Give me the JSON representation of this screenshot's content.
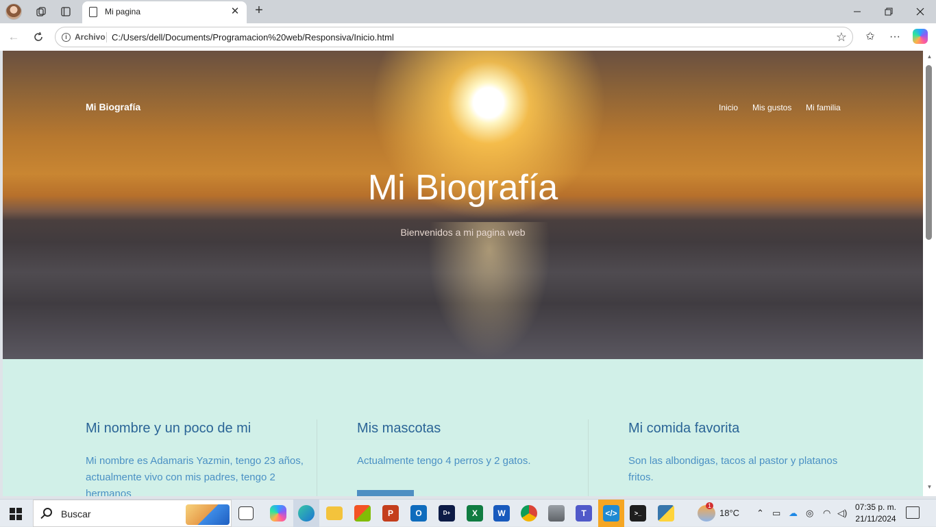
{
  "browser": {
    "tab_title": "Mi pagina",
    "close_glyph": "✕",
    "new_tab_glyph": "+",
    "scheme_label": "Archivo",
    "url": "C:/Users/dell/Documents/Programacion%20web/Responsiva/Inicio.html",
    "icons": [
      "profile-avatar",
      "workspaces-icon",
      "tab-actions-icon",
      "document-icon",
      "back-icon",
      "refresh-icon",
      "info-icon",
      "favorite-star-icon",
      "favorites-icon",
      "more-icon",
      "copilot-icon",
      "minimize-icon",
      "restore-icon",
      "close-icon"
    ]
  },
  "page": {
    "brand": "Mi Biografía",
    "nav": [
      "Inicio",
      "Mis gustos",
      "Mi familia"
    ],
    "hero_title": "Mi Biografía",
    "hero_subtitle": "Bienvenidos a mi pagina web",
    "columns": [
      {
        "title": "Mi nombre y un poco de mi",
        "text": "Mi nombre es Adamaris Yazmin, tengo 23 años, actualmente vivo con mis padres, tengo 2 hermanos"
      },
      {
        "title": "Mis mascotas",
        "text": "Actualmente tengo 4 perros y 2 gatos."
      },
      {
        "title": "Mi comida favorita",
        "text": "Son las albondigas, tacos al pastor y platanos fritos."
      }
    ],
    "colors": {
      "section_bg": "#d1f0e8",
      "heading": "#2a6496",
      "body_text": "#4a90c4",
      "button": "#4f8fc2"
    }
  },
  "taskbar": {
    "search_label": "Buscar",
    "weather_temp": "18°C",
    "weather_badge": "1",
    "time": "07:35 p. m.",
    "date": "21/11/2024",
    "apps": [
      "task-view-icon",
      "copilot-app-icon",
      "edge-icon",
      "file-explorer-icon",
      "store-icon",
      "powerpoint-icon",
      "outlook-icon",
      "disney-plus-icon",
      "excel-icon",
      "word-icon",
      "chrome-icon",
      "database-icon",
      "teams-icon",
      "vscode-icon",
      "terminal-icon",
      "python-icon"
    ]
  }
}
